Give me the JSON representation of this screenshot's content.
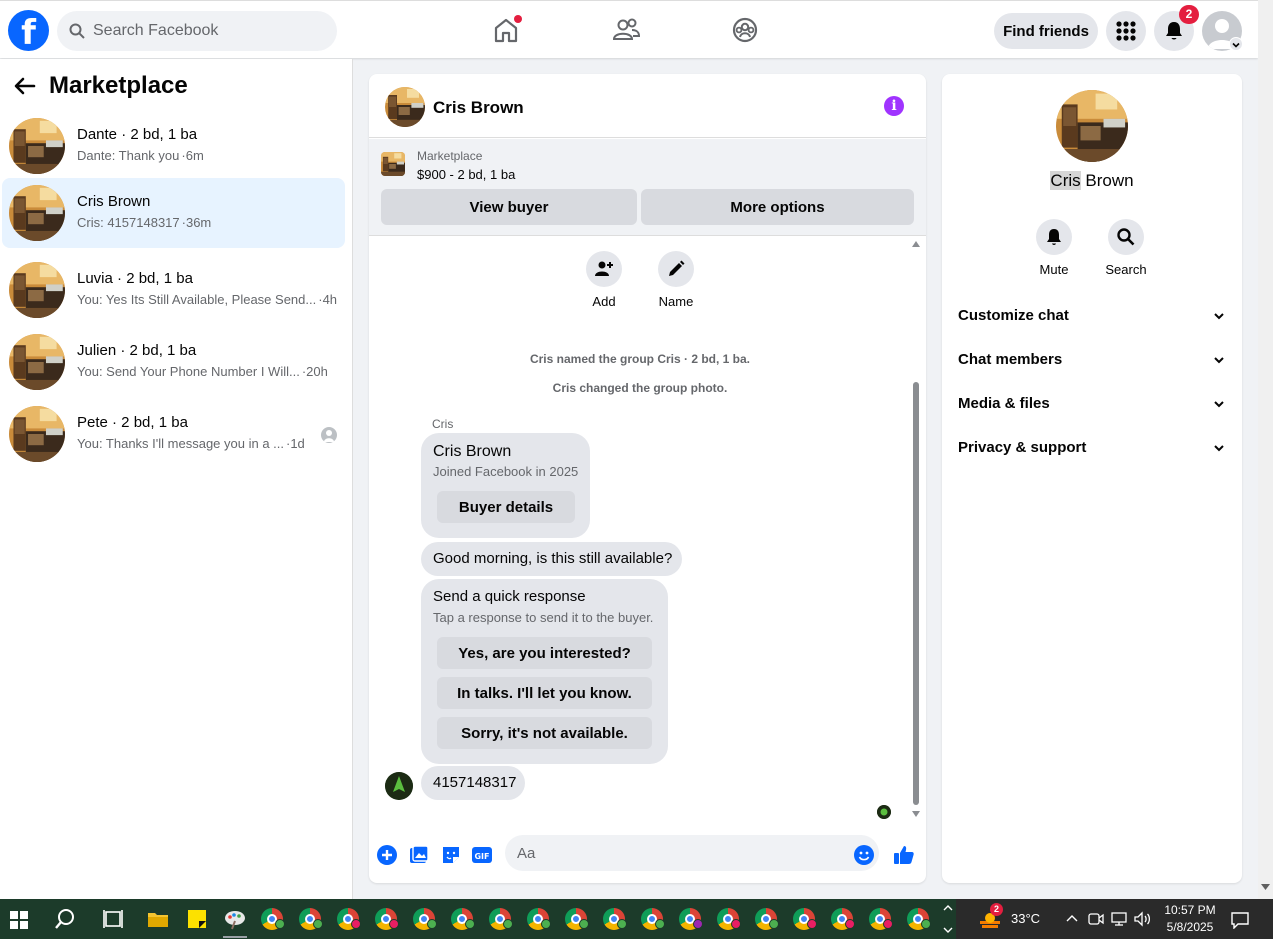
{
  "topbar": {
    "search_placeholder": "Search Facebook",
    "find_friends_label": "Find friends",
    "notification_count": "2"
  },
  "sidebar": {
    "title": "Marketplace",
    "conversations": [
      {
        "name": "Dante · 2 bd, 1 ba",
        "preview": "Dante: Thank you",
        "time": "·6m",
        "active": false
      },
      {
        "name": "Cris Brown",
        "preview": "Cris: 4157148317",
        "time": "·36m",
        "active": true
      },
      {
        "name": "Luvia · 2 bd, 1 ba",
        "preview": "You: Yes Its Still Available, Please Send...",
        "time": "·4h",
        "active": false
      },
      {
        "name": "Julien · 2 bd, 1 ba",
        "preview": "You: Send Your Phone Number I Will...",
        "time": "·20h",
        "active": false
      },
      {
        "name": "Pete · 2 bd, 1 ba",
        "preview": "You: Thanks I'll message you in a ...",
        "time": "·1d",
        "active": false
      }
    ]
  },
  "chat": {
    "title": "Cris Brown",
    "listing_label": "Marketplace",
    "listing_price": "$900 - 2 bd, 1 ba",
    "view_buyer_label": "View buyer",
    "more_options_label": "More options",
    "actions": {
      "add": "Add",
      "name": "Name"
    },
    "system_messages": [
      "Cris named the group Cris · 2 bd, 1 ba.",
      "Cris changed the group photo."
    ],
    "sender_label": "Cris",
    "profile_card": {
      "name": "Cris Brown",
      "joined": "Joined Facebook in 2025",
      "button": "Buyer details"
    },
    "message_1": "Good morning, is this still available?",
    "quick_response": {
      "title": "Send a quick response",
      "subtitle": "Tap a response to send it to the buyer.",
      "options": [
        "Yes, are you interested?",
        "In talks. I'll let you know.",
        "Sorry, it's not available."
      ]
    },
    "message_2": "4157148317",
    "composer_placeholder": "Aa"
  },
  "details": {
    "name_first": "Cris",
    "name_last": " Brown",
    "mute_label": "Mute",
    "search_label": "Search",
    "sections": [
      "Customize chat",
      "Chat members",
      "Media & files",
      "Privacy & support"
    ]
  },
  "taskbar": {
    "temperature": "33°C",
    "time": "10:57 PM",
    "date": "5/8/2025",
    "weather_badge": "2"
  },
  "colors": {
    "brand": "#0866ff",
    "notification": "#e41e3f",
    "info": "#a033ff",
    "active_row": "#e7f3ff"
  }
}
